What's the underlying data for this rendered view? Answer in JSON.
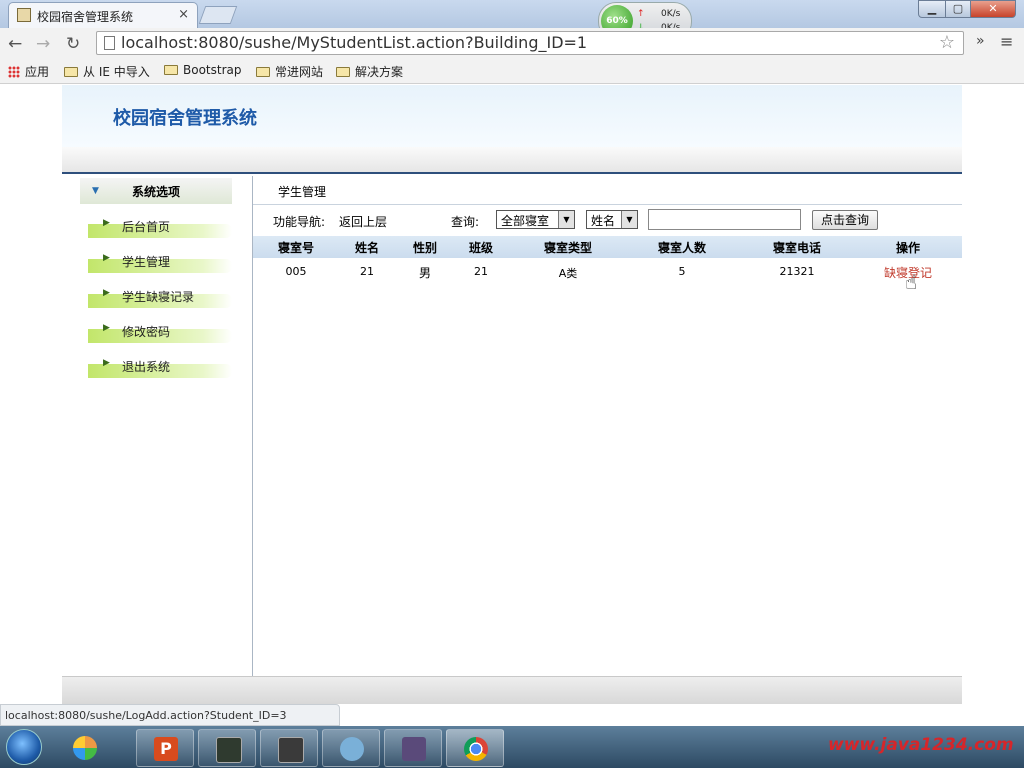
{
  "browser": {
    "tab_title": "校园宿舍管理系统",
    "tab_close": "×",
    "url": "localhost:8080/sushe/MyStudentList.action?Building_ID=1",
    "network_widget": {
      "percent": "60%",
      "up_rate": "0K/s",
      "down_rate": "0K/s"
    },
    "bookmarks": [
      "应用",
      "从 IE 中导入",
      "Bootstrap",
      "常进网站",
      "解决方案"
    ],
    "overflow": "»",
    "status_url": "localhost:8080/sushe/LogAdd.action?Student_ID=3"
  },
  "header": {
    "title": "校园宿舍管理系统"
  },
  "sidebar": {
    "heading": "系统选项",
    "items": [
      {
        "label": "后台首页"
      },
      {
        "label": "学生管理"
      },
      {
        "label": "学生缺寝记录"
      },
      {
        "label": "修改密码"
      },
      {
        "label": "退出系统"
      }
    ]
  },
  "main": {
    "title": "学生管理",
    "nav_label": "功能导航:",
    "back_link": "返回上层",
    "query_label": "查询:",
    "room_select": "全部寝室",
    "field_select": "姓名",
    "search_value": "",
    "search_button": "点击查询",
    "columns": [
      "寝室号",
      "姓名",
      "性别",
      "班级",
      "寝室类型",
      "寝室人数",
      "寝室电话",
      "操作"
    ],
    "rows": [
      {
        "room": "005",
        "name": "21",
        "gender": "男",
        "class": "21",
        "type": "A类",
        "count": "5",
        "phone": "21321",
        "action": "缺寝登记"
      }
    ]
  },
  "taskbar": {
    "watermark": "www.java1234.com"
  },
  "colors": {
    "title_blue": "#1e5aa8",
    "link_red": "#c0392b",
    "header_bar": "#2e4f7c"
  }
}
